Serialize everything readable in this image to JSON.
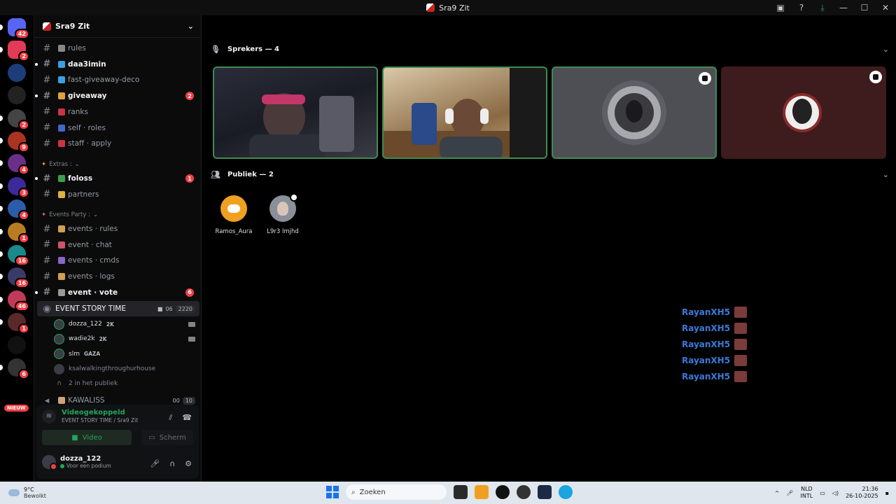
{
  "window": {
    "title": "Sra9 Zit"
  },
  "rail": {
    "servers": [
      {
        "name": "direct-messages",
        "badge": "42",
        "color": "#5865f2"
      },
      {
        "name": "server-1",
        "badge": "2",
        "color": "#e23b57"
      },
      {
        "name": "server-2",
        "badge": "",
        "color": "#1d3d7a"
      },
      {
        "name": "server-3",
        "badge": "",
        "color": "#222222"
      },
      {
        "name": "server-4",
        "badge": "2",
        "color": "#444444"
      },
      {
        "name": "server-5",
        "badge": "9",
        "color": "#aa3322"
      },
      {
        "name": "server-6",
        "badge": "4",
        "color": "#6b2f8a"
      },
      {
        "name": "server-7",
        "badge": "3",
        "color": "#3d2a9a"
      },
      {
        "name": "server-8",
        "badge": "4",
        "color": "#2a5caa"
      },
      {
        "name": "server-9",
        "badge": "1",
        "color": "#b87d22"
      },
      {
        "name": "server-10",
        "badge": "16",
        "color": "#1a8a8a"
      },
      {
        "name": "server-11",
        "badge": "16",
        "color": "#3a3a6a"
      },
      {
        "name": "server-12",
        "badge": "46",
        "color": "#c23a5a"
      },
      {
        "name": "server-13",
        "badge": "1",
        "color": "#5a2a2a"
      },
      {
        "name": "server-14",
        "badge": "",
        "color": "#111111"
      },
      {
        "name": "server-15",
        "badge": "6",
        "color": "#333333"
      }
    ],
    "new_label": "NIEUW"
  },
  "guild": {
    "name": "Sra9 Zit"
  },
  "channels": [
    {
      "label": "rules",
      "unread": false,
      "mention": ""
    },
    {
      "label": "daa3imin",
      "unread": true,
      "mention": ""
    },
    {
      "label": "fast-giveaway-deco",
      "unread": false,
      "mention": ""
    },
    {
      "label": "giveaway",
      "unread": true,
      "mention": "2"
    },
    {
      "label": "ranks",
      "unread": false,
      "mention": ""
    },
    {
      "label": "self · roles",
      "unread": false,
      "mention": ""
    },
    {
      "label": "staff · apply",
      "unread": false,
      "mention": ""
    }
  ],
  "category_extras": "Extras :",
  "extras_channels": [
    {
      "label": "foloss",
      "unread": true,
      "mention": "1"
    },
    {
      "label": "partners",
      "unread": false,
      "mention": ""
    }
  ],
  "category_events": "Events Party :",
  "events_channels": [
    {
      "label": "events · rules",
      "unread": false,
      "mention": ""
    },
    {
      "label": "event · chat",
      "unread": false,
      "mention": ""
    },
    {
      "label": "events · cmds",
      "unread": false,
      "mention": ""
    },
    {
      "label": "events · logs",
      "unread": false,
      "mention": ""
    },
    {
      "label": "event · vote",
      "unread": true,
      "mention": "6"
    }
  ],
  "stage_channel": {
    "label": "EVENT STORY TIME",
    "count_a": "06",
    "count_b": "2220"
  },
  "voice_users": [
    {
      "name": "dozza_122",
      "tag": "2K",
      "cam": true
    },
    {
      "name": "wadie2k",
      "tag": "2K",
      "cam": true
    },
    {
      "name": "slm",
      "tag": "GAZA",
      "cam": false
    },
    {
      "name": "ksalwalkingthroughurhouse",
      "tag": "",
      "cam": false
    }
  ],
  "audience_line": "2 in het publiek",
  "next_channel": {
    "label": "KAWALISS",
    "count_a": "00",
    "count_b": "10"
  },
  "voice_panel": {
    "status": "Videogekoppeld",
    "channel": "EVENT STORY TIME / Sra9 Zit",
    "video_label": "Video",
    "screen_label": "Scherm"
  },
  "user": {
    "name": "dozza_122",
    "substatus": "Voor een podium"
  },
  "stage": {
    "speakers_heading": "Sprekers — 4",
    "audience_heading": "Publiek — 2",
    "audience": [
      {
        "name": "Ramos_Aura",
        "color": "#f0a020"
      },
      {
        "name": "L9r3 lmjhd",
        "color": "#8a8f99"
      }
    ],
    "overlay_names": [
      "RayanXH5",
      "RayanXH5",
      "RayanXH5",
      "RayanXH5",
      "RayanXH5"
    ]
  },
  "taskbar": {
    "temp": "9°C",
    "weather": "Bewolkt",
    "search_placeholder": "Zoeken",
    "lang_top": "NLD",
    "lang_bottom": "INTL",
    "time": "21:36",
    "date": "26-10-2025"
  }
}
